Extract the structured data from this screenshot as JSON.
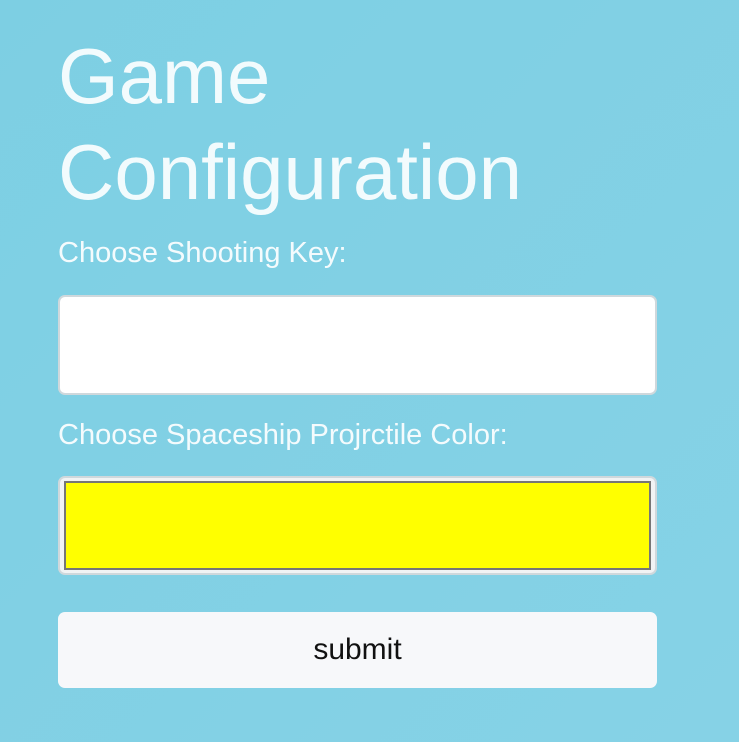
{
  "form": {
    "title_line1": "Game",
    "title_line2": "Configuration",
    "shooting_key_label": "Choose Shooting Key:",
    "shooting_key_value": "",
    "projectile_color_label": "Choose Spaceship Projrctile Color:",
    "projectile_color_value": "#ffff00",
    "submit_label": "submit"
  },
  "colors": {
    "background": "#80d0e4",
    "text": "#f2fbfd",
    "swatch": "#ffff00",
    "button_bg": "#f7f8fa"
  }
}
